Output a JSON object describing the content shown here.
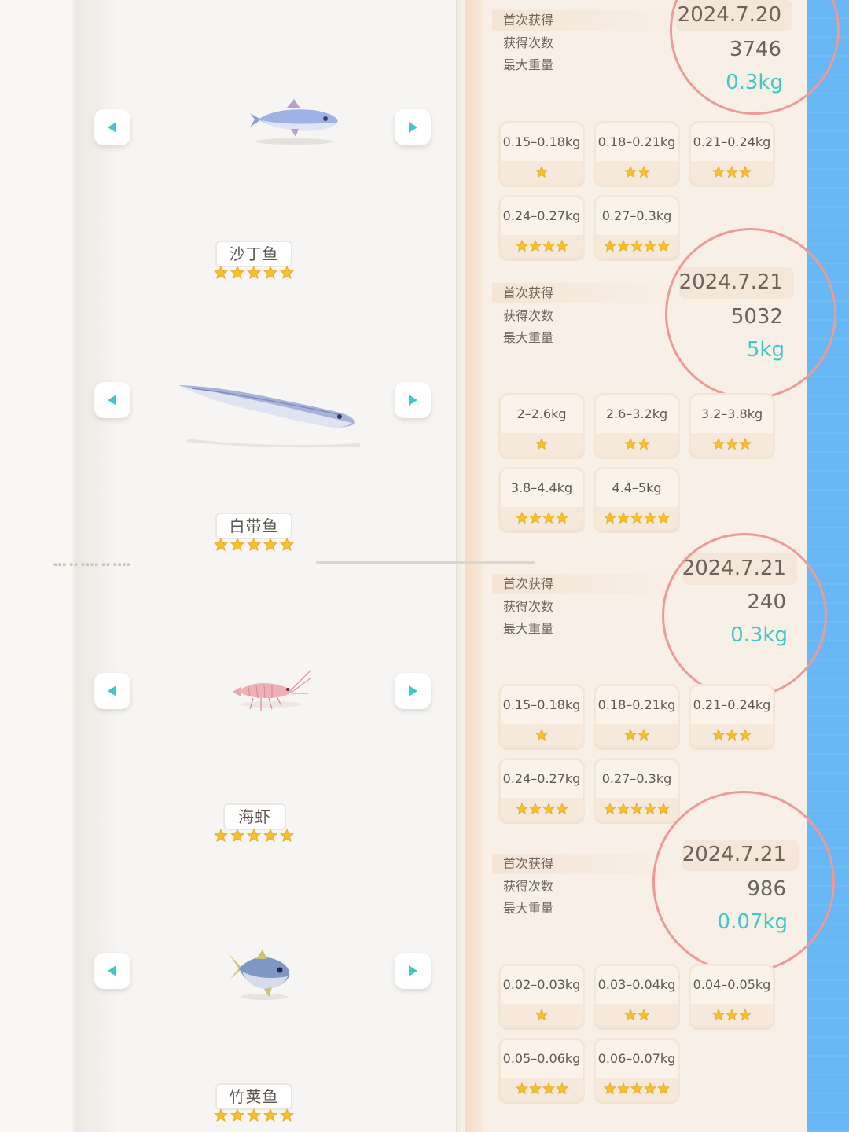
{
  "fish": [
    {
      "name": "沙丁鱼",
      "stars": 5,
      "icon": "sardine-fish-icon"
    },
    {
      "name": "白带鱼",
      "stars": 5,
      "icon": "ribbonfish-icon"
    },
    {
      "name": "海虾",
      "stars": 5,
      "icon": "shrimp-icon"
    },
    {
      "name": "竹荚鱼",
      "stars": 5,
      "icon": "jack-mackerel-icon"
    }
  ],
  "record_labels": {
    "first_caught": "首次获得",
    "catch_count": "获得次数",
    "max_weight": "最大重量"
  },
  "records": [
    {
      "date": "2024.7.20",
      "count": "3746",
      "weight": "0.3kg"
    },
    {
      "date": "2024.7.21",
      "count": "5032",
      "weight": "5kg"
    },
    {
      "date": "2024.7.21",
      "count": "240",
      "weight": "0.3kg"
    },
    {
      "date": "2024.7.21",
      "count": "986",
      "weight": "0.07kg"
    }
  ],
  "weight_tiers": [
    [
      {
        "range": "0.15–0.18kg",
        "stars": 1
      },
      {
        "range": "0.18–0.21kg",
        "stars": 2
      },
      {
        "range": "0.21–0.24kg",
        "stars": 3
      },
      {
        "range": "0.24–0.27kg",
        "stars": 4
      },
      {
        "range": "0.27–0.3kg",
        "stars": 5
      }
    ],
    [
      {
        "range": "2–2.6kg",
        "stars": 1
      },
      {
        "range": "2.6–3.2kg",
        "stars": 2
      },
      {
        "range": "3.2–3.8kg",
        "stars": 3
      },
      {
        "range": "3.8–4.4kg",
        "stars": 4
      },
      {
        "range": "4.4–5kg",
        "stars": 5
      }
    ],
    [
      {
        "range": "0.15–0.18kg",
        "stars": 1
      },
      {
        "range": "0.18–0.21kg",
        "stars": 2
      },
      {
        "range": "0.21–0.24kg",
        "stars": 3
      },
      {
        "range": "0.24–0.27kg",
        "stars": 4
      },
      {
        "range": "0.27–0.3kg",
        "stars": 5
      }
    ],
    [
      {
        "range": "0.02–0.03kg",
        "stars": 1
      },
      {
        "range": "0.03–0.04kg",
        "stars": 2
      },
      {
        "range": "0.04–0.05kg",
        "stars": 3
      },
      {
        "range": "0.05–0.06kg",
        "stars": 4
      },
      {
        "range": "0.06–0.07kg",
        "stars": 5
      }
    ]
  ],
  "colors": {
    "accent_teal": "#3fc9c6",
    "circle_pink": "#ee9b98",
    "star_gold": "#f4c02c",
    "side_blue": "#67b8f4"
  }
}
